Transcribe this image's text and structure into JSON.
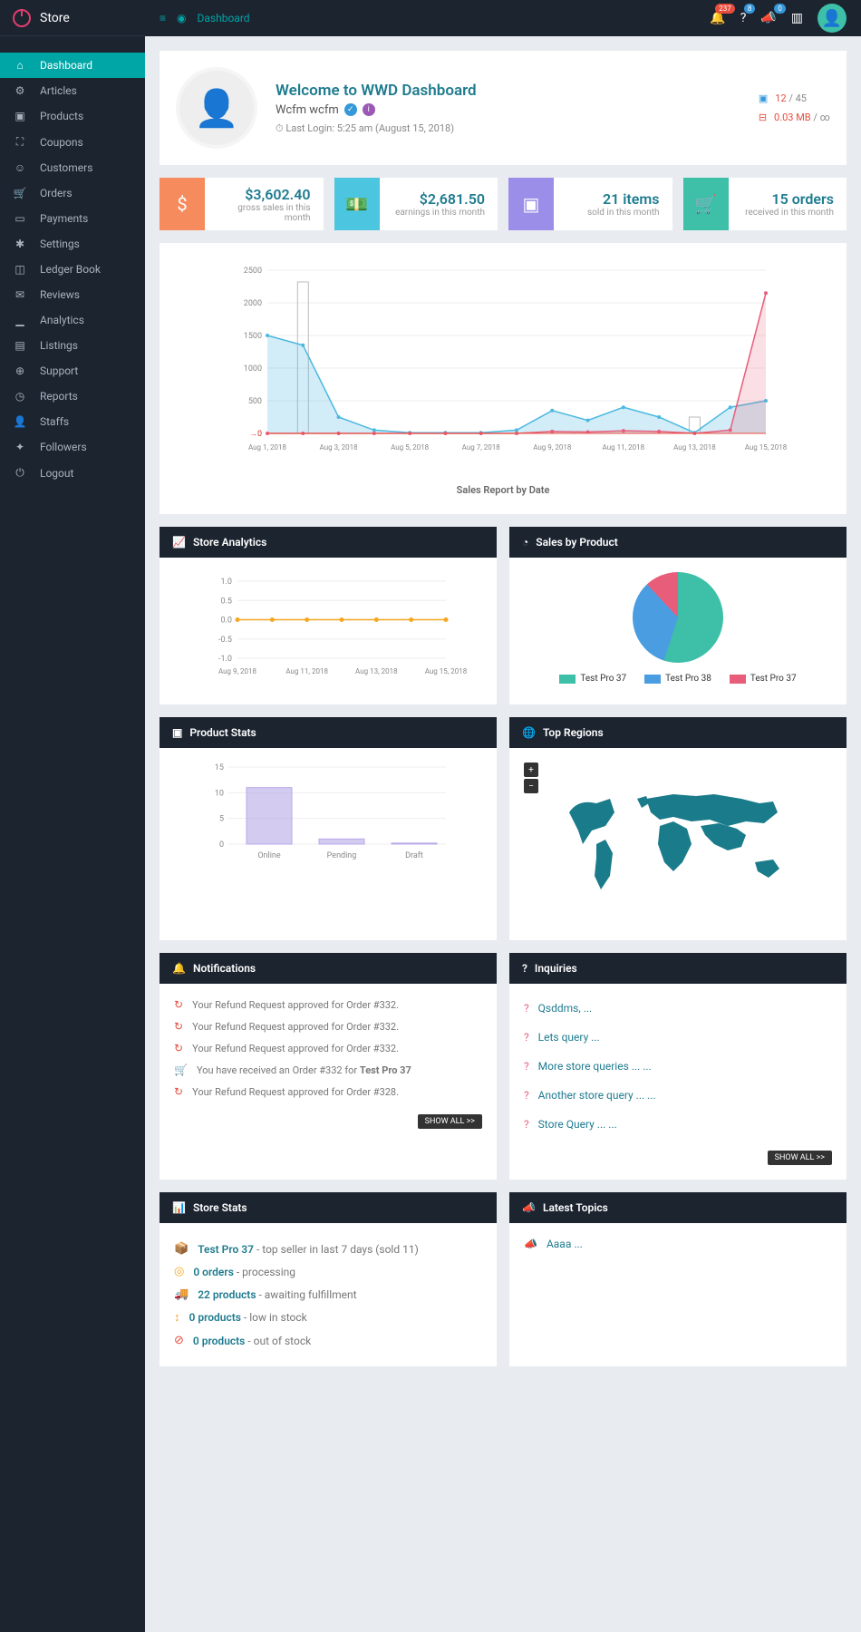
{
  "brand": "Store",
  "breadcrumb": "Dashboard",
  "topbar": {
    "notif_badge": "237",
    "help_badge": "8",
    "announce_badge": "0"
  },
  "sidebar": [
    {
      "label": "Dashboard",
      "icon": "⌂",
      "active": true
    },
    {
      "label": "Articles",
      "icon": "⚙"
    },
    {
      "label": "Products",
      "icon": "▣"
    },
    {
      "label": "Coupons",
      "icon": "⛶"
    },
    {
      "label": "Customers",
      "icon": "☺"
    },
    {
      "label": "Orders",
      "icon": "🛒"
    },
    {
      "label": "Payments",
      "icon": "▭"
    },
    {
      "label": "Settings",
      "icon": "✱"
    },
    {
      "label": "Ledger Book",
      "icon": "◫"
    },
    {
      "label": "Reviews",
      "icon": "✉"
    },
    {
      "label": "Analytics",
      "icon": "▁"
    },
    {
      "label": "Listings",
      "icon": "▤"
    },
    {
      "label": "Support",
      "icon": "⊕"
    },
    {
      "label": "Reports",
      "icon": "◷"
    },
    {
      "label": "Staffs",
      "icon": "👤"
    },
    {
      "label": "Followers",
      "icon": "✦"
    },
    {
      "label": "Logout",
      "icon": "⏻"
    }
  ],
  "welcome": {
    "title": "Welcome to WWD Dashboard",
    "user": "Wcfm wcfm",
    "last_login_label": "Last Login:",
    "last_login": "5:25 am (August 15, 2018)",
    "stat1_a": "12",
    "stat1_b": "/ 45",
    "stat2_a": "0.03 MB",
    "stat2_b": "/ ∞"
  },
  "kpis": [
    {
      "value": "$3,602.40",
      "sub": "gross sales in this month"
    },
    {
      "value": "$2,681.50",
      "sub": "earnings in this month"
    },
    {
      "value": "21 items",
      "sub": "sold in this month"
    },
    {
      "value": "15 orders",
      "sub": "received in this month"
    }
  ],
  "chart_data": {
    "sales_report": {
      "type": "line",
      "title": "Sales Report by Date",
      "x_labels": [
        "Aug 1, 2018",
        "Aug 3, 2018",
        "Aug 5, 2018",
        "Aug 7, 2018",
        "Aug 9, 2018",
        "Aug 11, 2018",
        "Aug 13, 2018",
        "Aug 15, 2018"
      ],
      "ylim": [
        0,
        2500
      ],
      "y_ticks": [
        0,
        500,
        1000,
        1500,
        2000,
        2500
      ],
      "series": [
        {
          "name": "blue-area",
          "color": "#4bb8e0",
          "values": [
            1500,
            1350,
            250,
            50,
            10,
            10,
            10,
            50,
            350,
            200,
            400,
            250,
            10,
            400,
            500
          ]
        },
        {
          "name": "red-line",
          "color": "#e85d7a",
          "values": [
            0,
            0,
            0,
            0,
            0,
            0,
            0,
            0,
            30,
            20,
            40,
            30,
            0,
            50,
            2150
          ]
        },
        {
          "name": "bars",
          "color": "#ccc",
          "values": [
            0,
            2320,
            0,
            0,
            0,
            0,
            0,
            0,
            0,
            0,
            0,
            0,
            250,
            0,
            0
          ]
        }
      ]
    },
    "store_analytics": {
      "type": "line",
      "title": "Store Analytics",
      "x_labels": [
        "Aug 9, 2018",
        "Aug 11, 2018",
        "Aug 13, 2018",
        "Aug 15, 2018"
      ],
      "ylim": [
        -1.0,
        1.0
      ],
      "y_ticks": [
        -1.0,
        -0.5,
        0,
        0.5,
        1.0
      ],
      "series": [
        {
          "name": "visits",
          "color": "#f5a623",
          "values": [
            0,
            0,
            0,
            0,
            0,
            0,
            0
          ]
        }
      ]
    },
    "sales_by_product": {
      "type": "pie",
      "title": "Sales by Product",
      "series": [
        {
          "name": "Test Pro 37",
          "color": "#3dc0a7",
          "value": 55
        },
        {
          "name": "Test Pro 38",
          "color": "#4a9de0",
          "value": 33
        },
        {
          "name": "Test Pro 37",
          "color": "#e85d7a",
          "value": 12
        }
      ]
    },
    "product_stats": {
      "type": "bar",
      "title": "Product Stats",
      "categories": [
        "Online",
        "Pending",
        "Draft"
      ],
      "values": [
        11,
        1,
        0.2
      ],
      "ylim": [
        0,
        15
      ],
      "y_ticks": [
        0,
        5,
        10,
        15
      ],
      "color": "#b8a8e8"
    }
  },
  "panels": {
    "store_analytics": "Store Analytics",
    "sales_by_product": "Sales by Product",
    "product_stats": "Product Stats",
    "top_regions": "Top Regions",
    "notifications": "Notifications",
    "inquiries": "Inquiries",
    "store_stats": "Store Stats",
    "latest_topics": "Latest Topics"
  },
  "notifications": [
    "Your Refund Request approved for Order #332.",
    "Your Refund Request approved for Order #332.",
    "Your Refund Request approved for Order #332.",
    "You have received an Order #332 for Test Pro 37",
    "Your Refund Request approved for Order #328."
  ],
  "inquiries": [
    "Qsddms, ...",
    "Lets query ...",
    "More store queries ... ...",
    "Another store query ... ...",
    "Store Query ... ..."
  ],
  "show_all": "SHOW ALL >>",
  "store_stats": [
    {
      "icon": "📦",
      "color": "#4a9de0",
      "label": "Test Pro 37",
      "text": " - top seller in last 7 days (sold 11)"
    },
    {
      "icon": "◎",
      "color": "#f5a623",
      "label": "0 orders",
      "text": " - processing"
    },
    {
      "icon": "🚚",
      "color": "#e74c3c",
      "label": "22 products",
      "text": " - awaiting fulfillment"
    },
    {
      "icon": "↕",
      "color": "#f5a623",
      "label": "0 products",
      "text": " - low in stock"
    },
    {
      "icon": "⊘",
      "color": "#e74c3c",
      "label": "0 products",
      "text": " - out of stock"
    }
  ],
  "latest_topics": [
    "Aaaa ..."
  ]
}
